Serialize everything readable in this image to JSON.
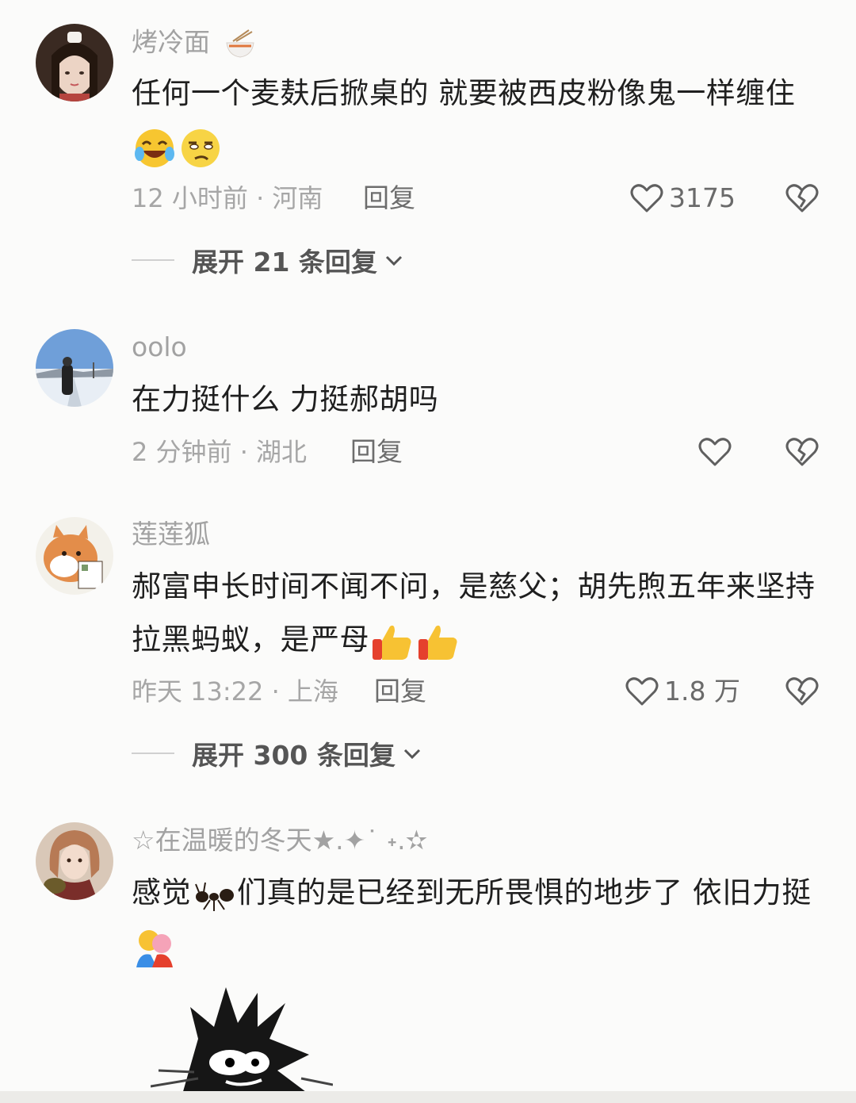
{
  "comments": [
    {
      "username": "烤冷面",
      "text_before_emoji": "任何一个麦麸后掀桌的 就要被西皮粉像鬼一样缠住",
      "emojis": [
        "laughing-crying-emoji",
        "unamused-emoji"
      ],
      "time_location": "12 小时前 · 河南",
      "reply": "回复",
      "likes": "3175",
      "expand": "展开 21 条回复",
      "avatar_colors": [
        "#3a2a22",
        "#e9d2c4",
        "#b5443e"
      ]
    },
    {
      "username": "oolo",
      "text_before_emoji": "在力挺什么 力挺郝胡吗",
      "emojis": [],
      "time_location": "2 分钟前 · 湖北",
      "reply": "回复",
      "likes": "",
      "avatar_colors": [
        "#6f9fd9",
        "#e8eef5",
        "#2b2b2b"
      ]
    },
    {
      "username": "莲莲狐",
      "text_before_emoji": "郝富申长时间不闻不问，是慈父；胡先煦五年来坚持拉黑蚂蚁，是严母",
      "emojis": [
        "thumbs-up-emoji",
        "thumbs-up-emoji"
      ],
      "time_location": "昨天 13:22 · 上海",
      "reply": "回复",
      "likes": "1.8 万",
      "expand": "展开 300 条回复",
      "avatar_colors": [
        "#f3f1ea",
        "#e38d4a",
        "#4c3a2a"
      ]
    },
    {
      "username": "☆在温暖的冬天★.✦˙ ˖.✫",
      "text_part1": "感觉",
      "text_part2": "们真的是已经到无所畏惧的地步了 依旧力挺",
      "emojis": [
        "ant-emoji",
        "hugging-emoji"
      ],
      "avatar_colors": [
        "#b77a55",
        "#f2dccd",
        "#7a2e2a"
      ]
    }
  ]
}
